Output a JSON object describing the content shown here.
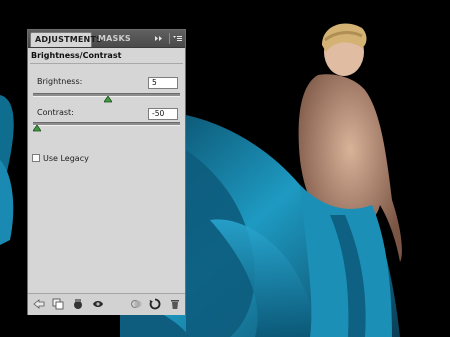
{
  "tabs": [
    {
      "label": "ADJUSTMENTS",
      "active": true
    },
    {
      "label": "MASKS",
      "active": false
    }
  ],
  "panel_title": "Brightness/Contrast",
  "brightness": {
    "label": "Brightness:",
    "value": "5",
    "slider_fraction": 0.51
  },
  "contrast": {
    "label": "Contrast:",
    "value": "-50",
    "slider_fraction": 0.0
  },
  "use_legacy": {
    "label": "Use Legacy",
    "checked": false
  },
  "header_icons": [
    "expand-arrows-icon",
    "panel-menu-icon"
  ],
  "bottom_icons": [
    "back-arrow-icon",
    "expanded-view-icon",
    "clip-to-layer-icon",
    "visibility-eye-icon",
    "view-previous-state-icon",
    "reset-icon",
    "delete-icon"
  ],
  "colors": {
    "panel_bg": "#d6d6d6",
    "tab_bar": "#535353",
    "fabric": "#1d8fb3",
    "background": "#000000"
  }
}
